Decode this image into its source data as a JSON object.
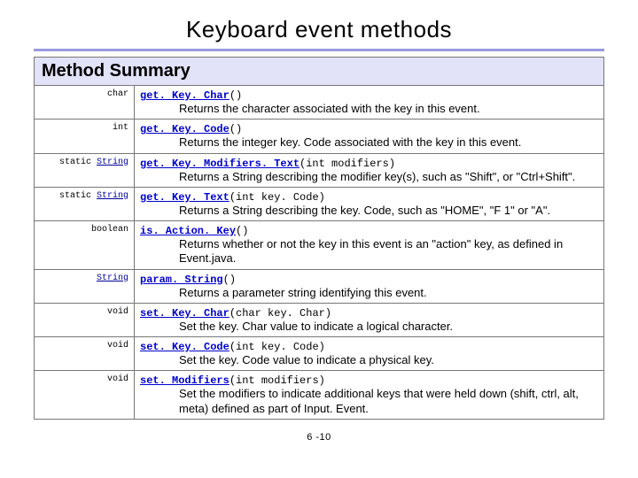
{
  "title": "Keyboard event methods",
  "header": "Method Summary",
  "rows": [
    {
      "ret": "char",
      "retLink": false,
      "name": "get. Key. Char",
      "params": "()",
      "desc": "Returns the character associated with the key in this event."
    },
    {
      "ret": "int",
      "retLink": false,
      "name": "get. Key. Code",
      "params": "()",
      "desc": "Returns the integer key. Code associated with the key in this event."
    },
    {
      "ret": "static String",
      "retLink": true,
      "retPlain": "static ",
      "retLinked": "String",
      "name": "get. Key. Modifiers. Text",
      "params": "(int modifiers)",
      "desc": "Returns a String describing the modifier key(s), such as \"Shift\", or \"Ctrl+Shift\"."
    },
    {
      "ret": "static String",
      "retLink": true,
      "retPlain": "static ",
      "retLinked": "String",
      "name": "get. Key. Text",
      "params": "(int key. Code)",
      "desc": "Returns a String describing the key. Code, such as \"HOME\", \"F 1\" or \"A\"."
    },
    {
      "ret": "boolean",
      "retLink": false,
      "name": "is. Action. Key",
      "params": "()",
      "desc": "Returns whether or not the key in this event is an \"action\" key, as defined in Event.java."
    },
    {
      "ret": "String",
      "retLink": true,
      "retPlain": "",
      "retLinked": "String",
      "name": "param. String",
      "params": "()",
      "desc": "Returns a parameter string identifying this event."
    },
    {
      "ret": "void",
      "retLink": false,
      "name": "set. Key. Char",
      "params": "(char key. Char)",
      "desc": "Set the key. Char value to indicate a logical character."
    },
    {
      "ret": "void",
      "retLink": false,
      "name": "set. Key. Code",
      "params": "(int key. Code)",
      "desc": "Set the key. Code value to indicate a physical key."
    },
    {
      "ret": "void",
      "retLink": false,
      "name": "set. Modifiers",
      "params": "(int modifiers)",
      "desc": "Set the modifiers to indicate additional keys that were held down (shift, ctrl, alt, meta) defined as part of Input. Event."
    }
  ],
  "pageNum": "6 -10"
}
